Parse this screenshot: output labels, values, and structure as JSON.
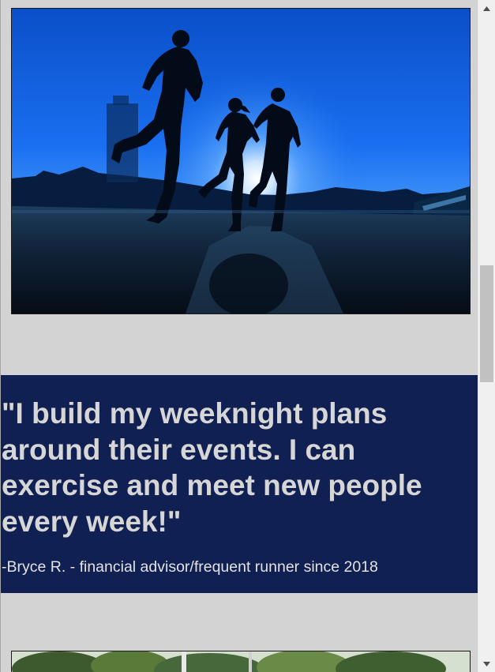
{
  "testimonial": {
    "quote": "\"I build my weeknight plans around their events. I can exercise and meet new people every week!\"",
    "author": "-Bryce R. - financial advisor/frequent runner since 2018",
    "background_color": "#112052"
  },
  "images": {
    "top": "runners-silhouette-photo",
    "bottom": "trees-photo"
  },
  "scrollbar": {
    "up_icon": "triangle-up-icon",
    "down_icon": "triangle-down-icon"
  }
}
